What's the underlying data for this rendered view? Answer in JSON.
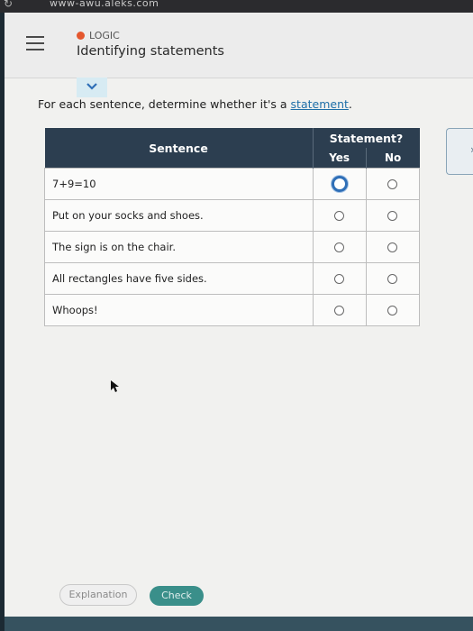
{
  "browser": {
    "url": "www-awu.aleks.com"
  },
  "header": {
    "topic": "LOGIC",
    "title": "Identifying statements"
  },
  "instruction": {
    "prefix": "For each sentence, determine whether it's a ",
    "link": "statement",
    "suffix": "."
  },
  "table": {
    "col_sentence": "Sentence",
    "col_statement": "Statement?",
    "col_yes": "Yes",
    "col_no": "No",
    "rows": [
      {
        "sentence": "7+9=10"
      },
      {
        "sentence": "Put on your socks and shoes."
      },
      {
        "sentence": "The sign is on the chair."
      },
      {
        "sentence": "All rectangles have five sides."
      },
      {
        "sentence": "Whoops!"
      }
    ]
  },
  "side_tab": {
    "glyph": "›"
  },
  "buttons": {
    "explanation": "Explanation",
    "check": "Check"
  },
  "colors": {
    "table_header": "#2c3e50",
    "topic_dot": "#e4572e",
    "link": "#1f6fa8",
    "check_button": "#3a8f8a",
    "focus_radio": "#2f6fb7"
  }
}
